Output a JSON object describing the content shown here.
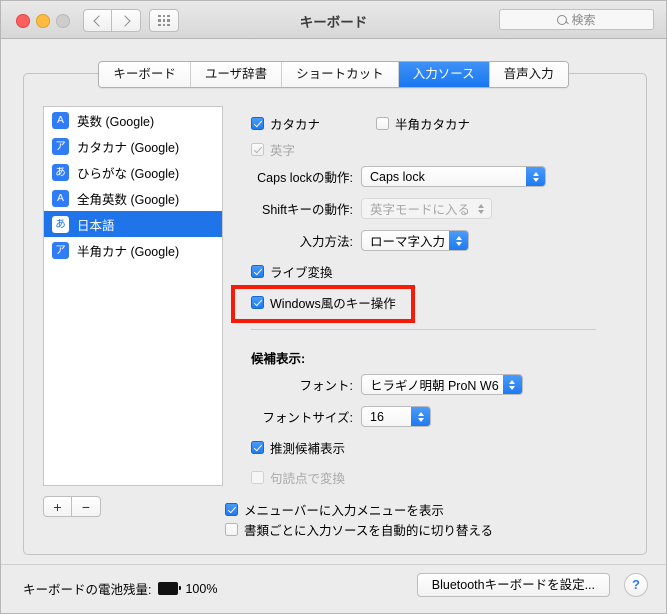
{
  "window": {
    "title": "キーボード",
    "traffic_lights": [
      "close",
      "minimize",
      "zoom"
    ],
    "search": {
      "placeholder": "検索",
      "value": ""
    }
  },
  "tabs": [
    {
      "label": "キーボード",
      "active": false
    },
    {
      "label": "ユーザ辞書",
      "active": false
    },
    {
      "label": "ショートカット",
      "active": false
    },
    {
      "label": "入力ソース",
      "active": true
    },
    {
      "label": "音声入力",
      "active": false
    }
  ],
  "source_list": {
    "items": [
      {
        "badge": "A",
        "label": "英数 (Google)",
        "selected": false
      },
      {
        "badge": "ア",
        "label": "カタカナ (Google)",
        "selected": false
      },
      {
        "badge": "あ",
        "label": "ひらがな (Google)",
        "selected": false
      },
      {
        "badge": "A",
        "label": "全角英数 (Google)",
        "selected": false
      },
      {
        "badge": "あ",
        "label": "日本語",
        "selected": true
      },
      {
        "badge": "ア",
        "label": "半角カナ (Google)",
        "selected": false
      }
    ],
    "add_button": "+",
    "remove_button": "−"
  },
  "settings": {
    "katakana": {
      "label": "カタカナ",
      "checked": true,
      "enabled": true
    },
    "hankaku_katakana": {
      "label": "半角カタカナ",
      "checked": false,
      "enabled": true
    },
    "eiji": {
      "label": "英字",
      "checked": true,
      "enabled": false
    },
    "caps_lock": {
      "label": "Caps lockの動作:",
      "value": "Caps lock",
      "enabled": true
    },
    "shift_key": {
      "label": "Shiftキーの動作:",
      "value": "英字モードに入る",
      "enabled": false
    },
    "input_method": {
      "label": "入力方法:",
      "value": "ローマ字入力",
      "enabled": true
    },
    "live_conversion": {
      "label": "ライブ変換",
      "checked": true,
      "enabled": true
    },
    "windows_keys": {
      "label": "Windows風のキー操作",
      "checked": true,
      "enabled": true
    },
    "candidates_heading": "候補表示:",
    "font": {
      "label": "フォント:",
      "value": "ヒラギノ明朝 ProN W6",
      "enabled": true
    },
    "font_size": {
      "label": "フォントサイズ:",
      "value": "16",
      "enabled": true
    },
    "predictive": {
      "label": "推測候補表示",
      "checked": true,
      "enabled": true
    },
    "punctuation": {
      "label": "句読点で変換",
      "checked": false,
      "enabled": false
    }
  },
  "bottom_options": [
    {
      "label": "メニューバーに入力メニューを表示",
      "checked": true
    },
    {
      "label": "書類ごとに入力ソースを自動的に切り替える",
      "checked": false
    }
  ],
  "footer": {
    "battery_label": "キーボードの電池残量:",
    "battery_value": "100%",
    "bluetooth_button": "Bluetoothキーボードを設定...",
    "help_button": "?"
  },
  "annotation": {
    "color": "#f61a09",
    "target": "Windows風のキー操作"
  },
  "colors": {
    "accent": "#1d7bf0",
    "selection": "#1e74e8",
    "badge": "#2f7cf6",
    "annotation": "#f61a09",
    "window_bg": "#ececec"
  }
}
